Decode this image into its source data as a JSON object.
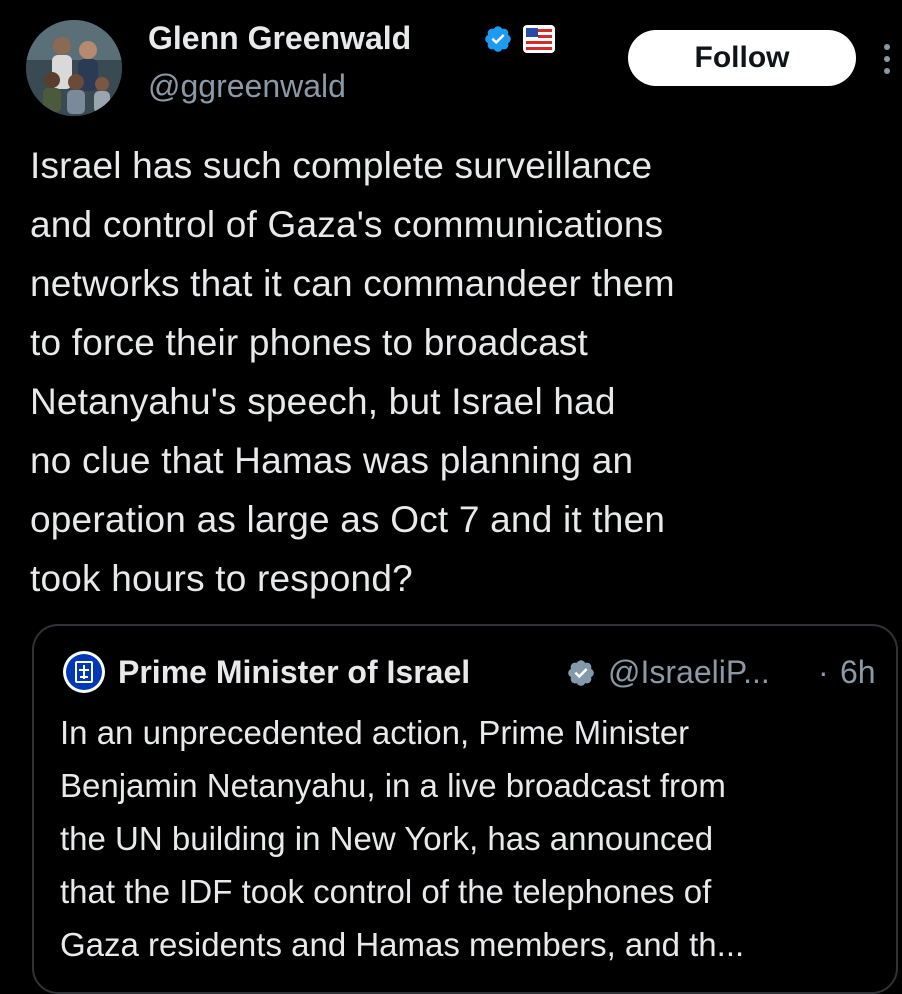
{
  "tweet": {
    "author": {
      "name": "Glenn Greenwald",
      "handle": "@ggreenwald",
      "avatar_icon": "profile-photo-icon",
      "verified_icon": "verified-badge-icon",
      "affiliation_icon": "flag-badge-icon"
    },
    "follow_label": "Follow",
    "more_icon": "more-options-icon",
    "text": "Israel has such complete surveillance\nand control of Gaza's communications\nnetworks that it can commandeer them\nto force their phones to broadcast\nNetanyahu's speech, but Israel had\nno clue that Hamas was planning an\noperation as large as Oct 7 and it then\ntook hours to respond?"
  },
  "quote": {
    "author": {
      "name": "Prime Minister of Israel",
      "handle": "@IsraeliP...",
      "avatar_icon": "government-emblem-icon",
      "verified_icon": "verified-grey-badge-icon"
    },
    "separator": "·",
    "time": "6h",
    "text": "In an unprecedented action, Prime Minister\nBenjamin Netanyahu, in a live broadcast from\nthe UN building in New York, has announced\nthat the IDF took control of the telephones of\nGaza residents and Hamas members, and th..."
  },
  "colors": {
    "background": "#000000",
    "primary_text": "#e7e9ea",
    "secondary_text": "#8b98a5",
    "verified_blue": "#1d9bf0",
    "verified_grey": "#829aab",
    "border": "#2f3336",
    "follow_bg": "#ffffff"
  }
}
